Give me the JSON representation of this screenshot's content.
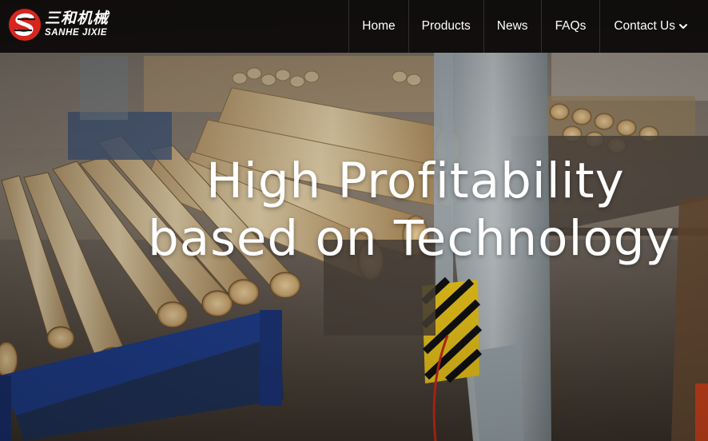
{
  "header": {
    "logo": {
      "name_cn": "三和机械",
      "name_en": "SANHE JIXIE",
      "mark_icon": "sanhe-s-logo-icon",
      "mark_color": "#d7261e"
    },
    "nav": [
      {
        "label": "Home"
      },
      {
        "label": "Products"
      },
      {
        "label": "News"
      },
      {
        "label": "FAQs"
      },
      {
        "label": "Contact Us",
        "icon": "chevron-down-icon"
      }
    ]
  },
  "hero": {
    "title_line1": "High Profitability",
    "title_line2": "based on Technology",
    "background": "warehouse-with-stacked-logs-image"
  },
  "colors": {
    "header_bg": "#0c0a09",
    "text": "#ffffff",
    "accent": "#d7261e"
  }
}
